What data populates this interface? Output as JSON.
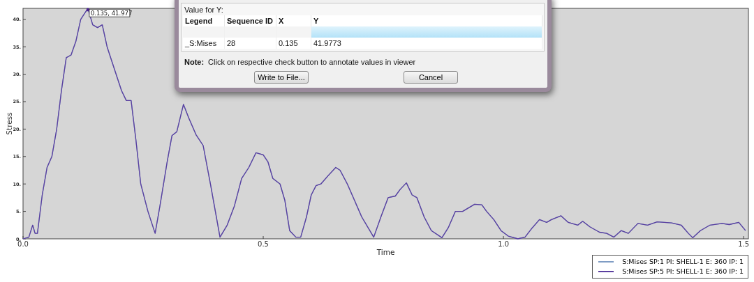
{
  "plot": {
    "chart_data": {
      "type": "line",
      "xlabel": "Time",
      "ylabel": "Stress",
      "xlim": [
        0,
        1.51
      ],
      "ylim": [
        0,
        42
      ],
      "xticks": [
        {
          "value": 0,
          "label": "0.0"
        },
        {
          "value": 0.5,
          "label": "0.5"
        },
        {
          "value": 1,
          "label": "1.0"
        },
        {
          "value": 1.5,
          "label": "1.5"
        }
      ],
      "yticks": [
        {
          "value": 0,
          "label": "0."
        },
        {
          "value": 5,
          "label": "5."
        },
        {
          "value": 10,
          "label": "10."
        },
        {
          "value": 15,
          "label": "15."
        },
        {
          "value": 20,
          "label": "20."
        },
        {
          "value": 25,
          "label": "25."
        },
        {
          "value": 30,
          "label": "30."
        },
        {
          "value": 35,
          "label": "35."
        },
        {
          "value": 40,
          "label": "40."
        }
      ],
      "x": [
        0,
        0.012,
        0.02,
        0.025,
        0.03,
        0.04,
        0.05,
        0.06,
        0.07,
        0.08,
        0.09,
        0.1,
        0.11,
        0.12,
        0.135,
        0.145,
        0.155,
        0.165,
        0.175,
        0.19,
        0.205,
        0.215,
        0.225,
        0.235,
        0.245,
        0.26,
        0.275,
        0.285,
        0.3,
        0.31,
        0.32,
        0.334,
        0.345,
        0.36,
        0.375,
        0.39,
        0.41,
        0.425,
        0.44,
        0.455,
        0.47,
        0.485,
        0.5,
        0.51,
        0.52,
        0.535,
        0.545,
        0.555,
        0.568,
        0.578,
        0.59,
        0.6,
        0.61,
        0.62,
        0.635,
        0.651,
        0.66,
        0.675,
        0.69,
        0.705,
        0.73,
        0.745,
        0.76,
        0.775,
        0.785,
        0.798,
        0.81,
        0.82,
        0.835,
        0.85,
        0.872,
        0.885,
        0.9,
        0.915,
        0.94,
        0.955,
        0.965,
        0.98,
        0.995,
        1.01,
        1.03,
        1.045,
        1.06,
        1.075,
        1.09,
        1.1,
        1.12,
        1.135,
        1.155,
        1.165,
        1.18,
        1.2,
        1.215,
        1.23,
        1.245,
        1.26,
        1.28,
        1.3,
        1.32,
        1.35,
        1.37,
        1.385,
        1.394,
        1.41,
        1.43,
        1.455,
        1.47,
        1.49,
        1.504
      ],
      "series": [
        {
          "name": "S:Mises SP:1 PI: SHELL-1 E: 360 IP: 1",
          "color": "#7f9cc4",
          "values": [
            0,
            0.3,
            2.5,
            1,
            1,
            8,
            13,
            15,
            20,
            27,
            33,
            33.5,
            36,
            40,
            42,
            39,
            38.5,
            39,
            35,
            31,
            27,
            25.2,
            25.2,
            18,
            10,
            5,
            1,
            6,
            14,
            18.8,
            19.5,
            24.5,
            22,
            19,
            17,
            10,
            0.3,
            2.5,
            6,
            11,
            13,
            15.7,
            15.3,
            14,
            11,
            10,
            7,
            1.5,
            0.3,
            0.3,
            4,
            8,
            9.7,
            10,
            11.5,
            13,
            12.5,
            10,
            7,
            4,
            0.3,
            4,
            7.5,
            7.8,
            9,
            10.2,
            8,
            7.5,
            4,
            1.5,
            0.2,
            2,
            5,
            5,
            6.3,
            6.2,
            5,
            3.5,
            1.5,
            0.5,
            0,
            0.3,
            2,
            3.5,
            3,
            3.5,
            4.2,
            3,
            2.5,
            3.2,
            2.2,
            1.2,
            1,
            0.3,
            1.5,
            1,
            2.8,
            2.5,
            3.1,
            2.9,
            2.5,
            1,
            0.2,
            1.5,
            2.5,
            2.8,
            2.6,
            3,
            1.5
          ]
        },
        {
          "name": "S:Mises SP:5 PI: SHELL-1 E: 360 IP: 1",
          "color": "#5b3fa0",
          "values": [
            0,
            0.3,
            2.5,
            1,
            1,
            8,
            13,
            15,
            20,
            27,
            33,
            33.5,
            36,
            40,
            42,
            39,
            38.5,
            39,
            35,
            31,
            27,
            25.2,
            25.2,
            18,
            10,
            5,
            1,
            6,
            14,
            18.8,
            19.5,
            24.5,
            22,
            19,
            17,
            10,
            0.3,
            2.5,
            6,
            11,
            13,
            15.7,
            15.3,
            14,
            11,
            10,
            7,
            1.5,
            0.3,
            0.3,
            4,
            8,
            9.7,
            10,
            11.5,
            13,
            12.5,
            10,
            7,
            4,
            0.3,
            4,
            7.5,
            7.8,
            9,
            10.2,
            8,
            7.5,
            4,
            1.5,
            0.2,
            2,
            5,
            5,
            6.3,
            6.2,
            5,
            3.5,
            1.5,
            0.5,
            0,
            0.3,
            2,
            3.5,
            3,
            3.5,
            4.2,
            3,
            2.5,
            3.2,
            2.2,
            1.2,
            1,
            0.3,
            1.5,
            1,
            2.8,
            2.5,
            3.1,
            2.9,
            2.5,
            1,
            0.2,
            1.5,
            2.5,
            2.8,
            2.6,
            3,
            1.5
          ]
        }
      ],
      "annotations": [
        {
          "x": 0.135,
          "y": 41.977,
          "text": "0.135, 41.977"
        }
      ]
    }
  },
  "dialog": {
    "group_title": "Value for Y:",
    "columns": [
      "Legend",
      "Sequence ID",
      "X",
      "Y"
    ],
    "rows": [
      {
        "selected": true
      },
      {
        "selected": false,
        "cells": [
          "_S:Mises",
          "28",
          "0.135",
          "41.9773"
        ]
      }
    ],
    "note": {
      "label": "Note:",
      "text": "Click on respective check button to annotate values in viewer"
    },
    "buttons": [
      "Write to File...",
      "Cancel"
    ]
  }
}
